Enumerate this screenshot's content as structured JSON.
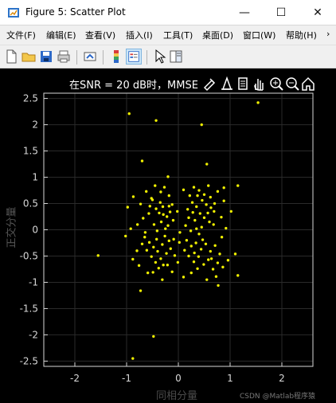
{
  "window": {
    "title": "Figure 5: Scatter Plot",
    "minimize_icon": "minimize-icon",
    "maximize_icon": "maximize-icon",
    "close_icon": "close-icon"
  },
  "menu": {
    "items": [
      {
        "label": "文件(F)"
      },
      {
        "label": "编辑(E)"
      },
      {
        "label": "查看(V)"
      },
      {
        "label": "插入(I)"
      },
      {
        "label": "工具(T)"
      },
      {
        "label": "桌面(D)"
      },
      {
        "label": "窗口(W)"
      },
      {
        "label": "帮助(H)"
      }
    ],
    "overflow": "›"
  },
  "toolbar": {
    "icons": [
      "new-figure-icon",
      "open-file-icon",
      "save-icon",
      "print-icon",
      "export-icon",
      "colorbar-icon",
      "legend-icon",
      "pointer-icon",
      "property-inspector-icon"
    ]
  },
  "figure": {
    "background": "#000000",
    "axes_title": "在SNR = 20 dB时，MMSE",
    "axes_toolbar": [
      "brush-icon",
      "data-tip-icon",
      "pan-icon",
      "zoom-in-icon",
      "zoom-out-icon",
      "home-icon"
    ],
    "watermark": "CSDN @Matlab程序猿"
  },
  "chart_data": {
    "type": "scatter",
    "title": "在SNR = 20 dB时，MMSE",
    "xlabel": "同相分量",
    "ylabel": "正交分量",
    "xlim": [
      -2.6,
      2.6
    ],
    "ylim": [
      -2.6,
      2.6
    ],
    "xticks": [
      -2,
      -1,
      0,
      1,
      2
    ],
    "yticks": [
      2.5,
      2,
      1.5,
      1,
      0.5,
      0,
      -0.5,
      -1,
      -1.5,
      -2,
      -2.5
    ],
    "ytick_labels": [
      "2.5",
      "2",
      "1.5",
      "1",
      "0.5",
      "0",
      "-0.5",
      "-1",
      "-1.5",
      "-2",
      "-2.5"
    ],
    "grid": true,
    "marker_color": "#f0f000",
    "background": "#000000",
    "axis_color": "#d7d7d7",
    "series": [
      {
        "points": [
          [
            1.54,
            2.42
          ],
          [
            -0.95,
            2.21
          ],
          [
            -0.43,
            2.08
          ],
          [
            0.45,
            2.0
          ],
          [
            -0.7,
            1.31
          ],
          [
            0.55,
            1.25
          ],
          [
            -0.2,
            1.01
          ],
          [
            0.88,
            0.8
          ],
          [
            1.15,
            0.84
          ],
          [
            -0.87,
            0.63
          ],
          [
            -0.62,
            0.73
          ],
          [
            -0.5,
            0.57
          ],
          [
            -0.34,
            0.72
          ],
          [
            -0.27,
            0.81
          ],
          [
            -0.18,
            0.65
          ],
          [
            -0.12,
            0.48
          ],
          [
            -0.43,
            0.4
          ],
          [
            -0.37,
            0.32
          ],
          [
            -0.29,
            0.29
          ],
          [
            -0.22,
            0.25
          ],
          [
            -0.16,
            0.34
          ],
          [
            -0.33,
            0.15
          ],
          [
            -0.47,
            0.1
          ],
          [
            -0.41,
            -0.02
          ],
          [
            -0.57,
            0.31
          ],
          [
            -0.68,
            0.22
          ],
          [
            -0.79,
            0.1
          ],
          [
            -0.64,
            -0.05
          ],
          [
            -0.1,
            0.18
          ],
          [
            -0.2,
            0.08
          ],
          [
            -0.55,
            0.45
          ],
          [
            -0.3,
            0.44
          ],
          [
            0.18,
            0.39
          ],
          [
            0.27,
            0.52
          ],
          [
            0.35,
            0.44
          ],
          [
            0.42,
            0.31
          ],
          [
            0.5,
            0.23
          ],
          [
            0.57,
            0.32
          ],
          [
            0.63,
            0.42
          ],
          [
            0.7,
            0.5
          ],
          [
            0.6,
            0.15
          ],
          [
            0.46,
            0.56
          ],
          [
            0.37,
            0.65
          ],
          [
            0.28,
            0.33
          ],
          [
            0.2,
            0.23
          ],
          [
            0.14,
            0.08
          ],
          [
            0.32,
            0.18
          ],
          [
            0.45,
            0.05
          ],
          [
            0.54,
            0.48
          ],
          [
            0.62,
            0.62
          ],
          [
            0.76,
            0.73
          ],
          [
            0.4,
            0.75
          ],
          [
            0.3,
            0.81
          ],
          [
            0.83,
            0.24
          ],
          [
            0.68,
            0.1
          ],
          [
            -0.56,
            -0.24
          ],
          [
            -0.48,
            -0.33
          ],
          [
            -0.4,
            -0.41
          ],
          [
            -0.31,
            -0.28
          ],
          [
            -0.23,
            -0.45
          ],
          [
            -0.15,
            -0.36
          ],
          [
            -0.07,
            -0.49
          ],
          [
            -0.34,
            -0.55
          ],
          [
            -0.44,
            -0.62
          ],
          [
            -0.52,
            -0.51
          ],
          [
            -0.61,
            -0.39
          ],
          [
            -0.7,
            -0.27
          ],
          [
            -0.26,
            -0.12
          ],
          [
            -0.18,
            -0.21
          ],
          [
            -0.09,
            -0.18
          ],
          [
            0.02,
            -0.24
          ],
          [
            -0.8,
            -0.4
          ],
          [
            -0.38,
            -0.73
          ],
          [
            -0.21,
            -0.67
          ],
          [
            -0.12,
            -0.8
          ],
          [
            -0.59,
            -0.82
          ],
          [
            -0.01,
            -0.62
          ],
          [
            -0.88,
            -0.56
          ],
          [
            -0.76,
            -0.68
          ],
          [
            0.16,
            -0.2
          ],
          [
            0.25,
            -0.31
          ],
          [
            0.34,
            -0.25
          ],
          [
            0.44,
            -0.37
          ],
          [
            0.53,
            -0.27
          ],
          [
            0.62,
            -0.41
          ],
          [
            0.71,
            -0.3
          ],
          [
            0.8,
            -0.46
          ],
          [
            0.2,
            -0.5
          ],
          [
            0.3,
            -0.61
          ],
          [
            0.39,
            -0.51
          ],
          [
            0.49,
            -0.66
          ],
          [
            0.58,
            -0.57
          ],
          [
            0.67,
            -0.75
          ],
          [
            0.76,
            -0.63
          ],
          [
            0.86,
            -0.71
          ],
          [
            0.12,
            -0.39
          ],
          [
            0.4,
            -0.08
          ],
          [
            0.25,
            -0.82
          ],
          [
            0.55,
            -0.95
          ],
          [
            0.73,
            -0.89
          ],
          [
            0.96,
            -0.58
          ],
          [
            1.1,
            -0.46
          ],
          [
            1.15,
            -0.87
          ],
          [
            -1.55,
            -0.49
          ],
          [
            -0.73,
            -1.16
          ],
          [
            0.77,
            -1.06
          ],
          [
            -0.48,
            -2.03
          ],
          [
            -0.88,
            -2.45
          ],
          [
            -0.92,
            0.02
          ],
          [
            -0.98,
            0.43
          ],
          [
            -1.02,
            -0.12
          ],
          [
            0.92,
            0.03
          ],
          [
            1.02,
            0.35
          ],
          [
            0.24,
            -0.02
          ],
          [
            -0.02,
            0.35
          ],
          [
            0.03,
            -0.05
          ],
          [
            -0.73,
            0.49
          ],
          [
            -0.45,
            0.84
          ],
          [
            0.1,
            0.76
          ],
          [
            0.58,
            0.84
          ],
          [
            0.88,
            0.55
          ],
          [
            0.84,
            -0.14
          ],
          [
            0.1,
            -0.9
          ],
          [
            -0.31,
            -0.95
          ],
          [
            -0.18,
            0.45
          ],
          [
            -0.35,
            0.52
          ],
          [
            -0.25,
            0.02
          ],
          [
            -0.52,
            0.6
          ],
          [
            0.5,
            0.67
          ],
          [
            0.35,
            0.02
          ],
          [
            0.69,
            0.35
          ],
          [
            0.22,
            0.65
          ],
          [
            -0.65,
            -0.14
          ],
          [
            -0.42,
            -0.18
          ],
          [
            -0.29,
            -0.67
          ],
          [
            -0.49,
            -0.81
          ],
          [
            0.31,
            -0.44
          ],
          [
            0.47,
            -0.19
          ],
          [
            0.64,
            -0.55
          ],
          [
            0.37,
            -0.74
          ]
        ]
      }
    ]
  }
}
